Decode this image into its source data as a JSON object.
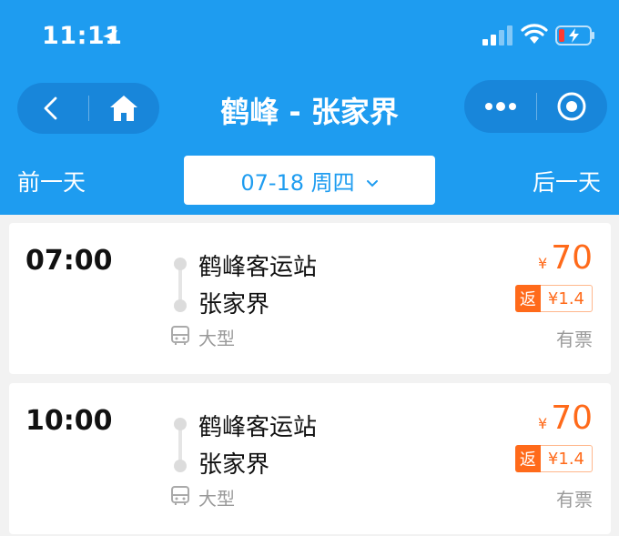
{
  "status_bar": {
    "time": "11:11"
  },
  "nav": {
    "title": "鹤峰 - 张家界"
  },
  "date_bar": {
    "prev_label": "前一天",
    "date_label": "07-18 周四",
    "next_label": "后一天"
  },
  "trips": [
    {
      "time": "07:00",
      "from": "鹤峰客运站",
      "to": "张家界",
      "bus_type": "大型",
      "currency": "¥",
      "price": "70",
      "rebate_tag": "返",
      "rebate_value": "¥1.4",
      "availability": "有票"
    },
    {
      "time": "10:00",
      "from": "鹤峰客运站",
      "to": "张家界",
      "bus_type": "大型",
      "currency": "¥",
      "price": "70",
      "rebate_tag": "返",
      "rebate_value": "¥1.4",
      "availability": "有票"
    }
  ],
  "colors": {
    "header_bg": "#1e9cf0",
    "accent": "#1e9cf0",
    "price": "#ff6a1a",
    "muted_text": "#999999"
  },
  "icons": [
    "location-arrow-icon",
    "signal-icon",
    "wifi-icon",
    "battery-icon",
    "back-icon",
    "home-icon",
    "more-icon",
    "target-icon",
    "chevron-down-icon",
    "route-line-icon",
    "bus-icon"
  ]
}
